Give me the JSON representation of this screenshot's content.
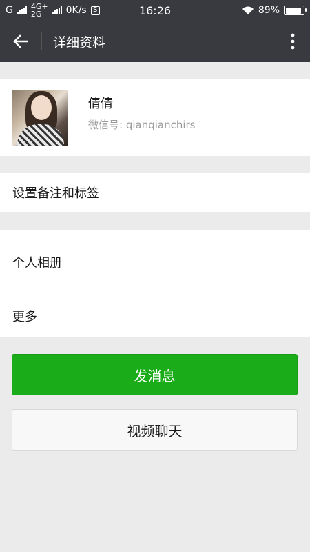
{
  "status_bar": {
    "carrier": "G",
    "network_top": "4G+",
    "network_bottom": "2G",
    "speed": "0K/s",
    "s_badge": "S",
    "time": "16:26",
    "battery": "89%",
    "battery_level": 0.89
  },
  "header": {
    "title": "详细资料"
  },
  "profile": {
    "name": "倩倩",
    "wechat_id": "微信号: qianqianchirs"
  },
  "menu": {
    "remark_tags": "设置备注和标签",
    "album": "个人相册",
    "more": "更多"
  },
  "actions": {
    "send_message": "发消息",
    "video_call": "视频聊天"
  },
  "colors": {
    "header_bg": "#393a3f",
    "primary": "#1aad19",
    "page_bg": "#ebebeb"
  }
}
